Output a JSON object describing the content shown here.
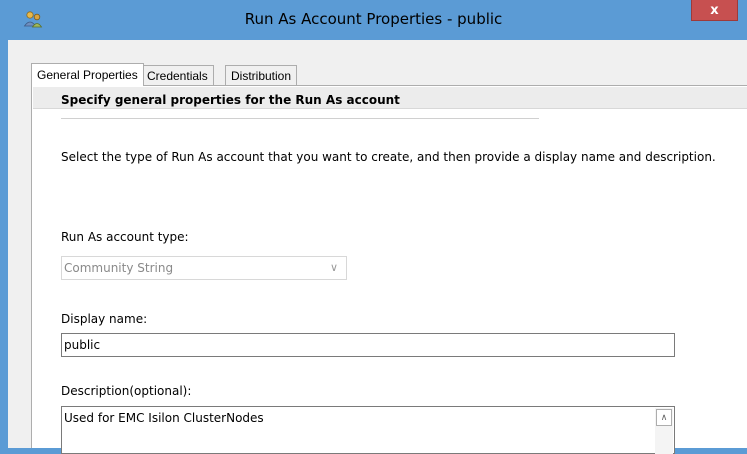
{
  "window": {
    "title": "Run As Account Properties - public",
    "close_glyph": "x",
    "app_icon": "run-as-account-icon"
  },
  "tabs": [
    {
      "label": "General Properties",
      "active": true
    },
    {
      "label": "Credentials",
      "active": false
    },
    {
      "label": "Distribution",
      "active": false
    }
  ],
  "page": {
    "heading": "Specify general properties for the Run As account",
    "description": "Select the type of Run As account that you want to create, and then provide a display name and description.",
    "account_type_label": "Run As account type:",
    "account_type_value": "Community String",
    "display_name_label": "Display name:",
    "display_name_value": "public",
    "description_label": "Description(optional):",
    "description_value": "Used for EMC Isilon ClusterNodes"
  },
  "colors": {
    "title_bar": "#5b9bd5",
    "close_button": "#c75050",
    "dialog_background": "#f0f0f0"
  }
}
